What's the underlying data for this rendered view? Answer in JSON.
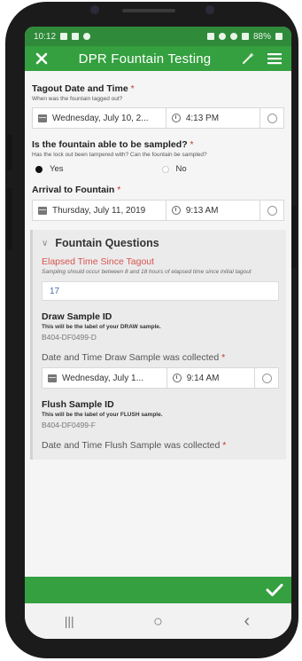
{
  "status_bar": {
    "time": "10:12",
    "battery": "88%"
  },
  "toolbar": {
    "title": "DPR Fountain Testing"
  },
  "tagout": {
    "label": "Tagout Date and Time",
    "required": "*",
    "hint": "When was the fountain tagged out?",
    "date": "Wednesday, July 10, 2...",
    "time": "4:13 PM"
  },
  "sampled": {
    "label": "Is the fountain able to be sampled?",
    "required": "*",
    "hint": "Has the lock out been tampered with? Can the fountain be sampled?",
    "options": [
      "Yes",
      "No"
    ],
    "selected": "Yes"
  },
  "arrival": {
    "label": "Arrival to Fountain",
    "required": "*",
    "date": "Thursday, July 11, 2019",
    "time": "9:13 AM"
  },
  "group": {
    "title": "Fountain Questions",
    "elapsed_label": "Elapsed Time Since Tagout",
    "elapsed_hint": "Sampling should occur between 8 and 18 hours of elapsed time since initial tagout",
    "elapsed_value": "17",
    "draw_id_label": "Draw Sample ID",
    "draw_id_hint": "This will be the label of your DRAW sample.",
    "draw_id_value": "B404-DF0499-D",
    "draw_dt_label": "Date and Time Draw Sample was collected",
    "draw_dt_required": "*",
    "draw_date": "Wednesday, July 1...",
    "draw_time": "9:14 AM",
    "flush_id_label": "Flush Sample ID",
    "flush_id_hint": "This will be the label of your FLUSH sample.",
    "flush_id_value": "B404-DF0499-F",
    "flush_dt_label": "Date and Time Flush Sample was collected",
    "flush_dt_required": "*"
  },
  "icons": {
    "close": "close-icon",
    "wand": "magic-wand-icon",
    "menu": "hamburger-menu-icon",
    "submit": "checkmark-icon",
    "calendar": "calendar-icon",
    "clock": "clock-icon",
    "clear": "clear-circle-icon",
    "chevron": "chevron-down-icon"
  },
  "colors": {
    "accent_green": "#34a03f",
    "status_green": "#2f8a3a",
    "required_red": "#c0392b",
    "elapsed_red": "#d9534f",
    "value_blue": "#4a6ea8"
  },
  "nav": {
    "recents": "|||",
    "home": "○",
    "back": "‹"
  }
}
